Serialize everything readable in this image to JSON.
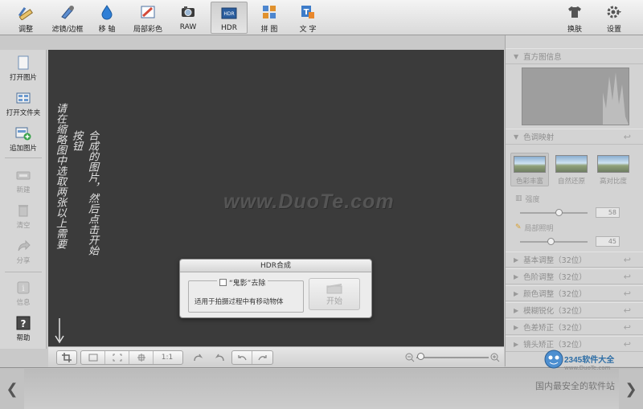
{
  "toolbar": {
    "items": [
      {
        "label": "调整",
        "icon": "ruler-pencil-icon"
      },
      {
        "label": "滤镜/边框",
        "icon": "filter-brush-icon"
      },
      {
        "label": "移 轴",
        "icon": "water-drop-icon"
      },
      {
        "label": "局部彩色",
        "icon": "color-brush-icon"
      },
      {
        "label": "RAW",
        "icon": "camera-icon"
      },
      {
        "label": "HDR",
        "icon": "hdr-icon",
        "active": true
      },
      {
        "label": "拼 图",
        "icon": "collage-icon"
      },
      {
        "label": "文 字",
        "icon": "text-t-icon"
      }
    ],
    "skin_label": "换肤",
    "settings_label": "设置"
  },
  "left_panel": {
    "items": [
      {
        "label": "打开图片",
        "enabled": true
      },
      {
        "label": "打开文件夹",
        "enabled": true
      },
      {
        "label": "追加图片",
        "enabled": true
      },
      {
        "label": "新建",
        "enabled": false
      },
      {
        "label": "清空",
        "enabled": false
      },
      {
        "label": "分享",
        "enabled": false
      },
      {
        "label": "信息",
        "enabled": false
      },
      {
        "label": "帮助",
        "enabled": true
      }
    ]
  },
  "canvas": {
    "hint_col1": "请在缩略图中选取两张以上需要",
    "hint_col2": "合成的图片，然后点击开始按钮",
    "watermark": "www.DuoTe.com"
  },
  "dialog": {
    "title": "HDR合成",
    "ghost_checkbox_label": "“鬼影”去除",
    "ghost_checked": false,
    "description": "适用于拍摄过程中有移动物体",
    "start_label": "开始"
  },
  "bottom_tools": {
    "ratio_label": "1:1"
  },
  "right_panel": {
    "histogram_title": "直方图信息",
    "tone_mapping_title": "色调映射",
    "presets": [
      {
        "label": "色彩丰富",
        "selected": true
      },
      {
        "label": "自然还原",
        "selected": false
      },
      {
        "label": "高对比度",
        "selected": false
      }
    ],
    "intensity": {
      "label": "强度",
      "value": "58"
    },
    "local_light": {
      "label": "局部照明",
      "value": "45"
    },
    "sections": [
      {
        "label": "基本调整（32位）"
      },
      {
        "label": "色阶调整（32位）"
      },
      {
        "label": "颜色调整（32位）"
      },
      {
        "label": "模糊锐化（32位）"
      },
      {
        "label": "色差矫正（32位）"
      },
      {
        "label": "镜头矫正（32位）"
      }
    ]
  },
  "branding": {
    "logo_text": "2345软件大全",
    "logo_sub": "www.DuoTe.com",
    "slogan": "国内最安全的软件站"
  },
  "colors": {
    "canvas_bg": "#3b3b3b",
    "panel_bg": "#d3d3d3",
    "accent_blue": "#2e6ea6"
  }
}
